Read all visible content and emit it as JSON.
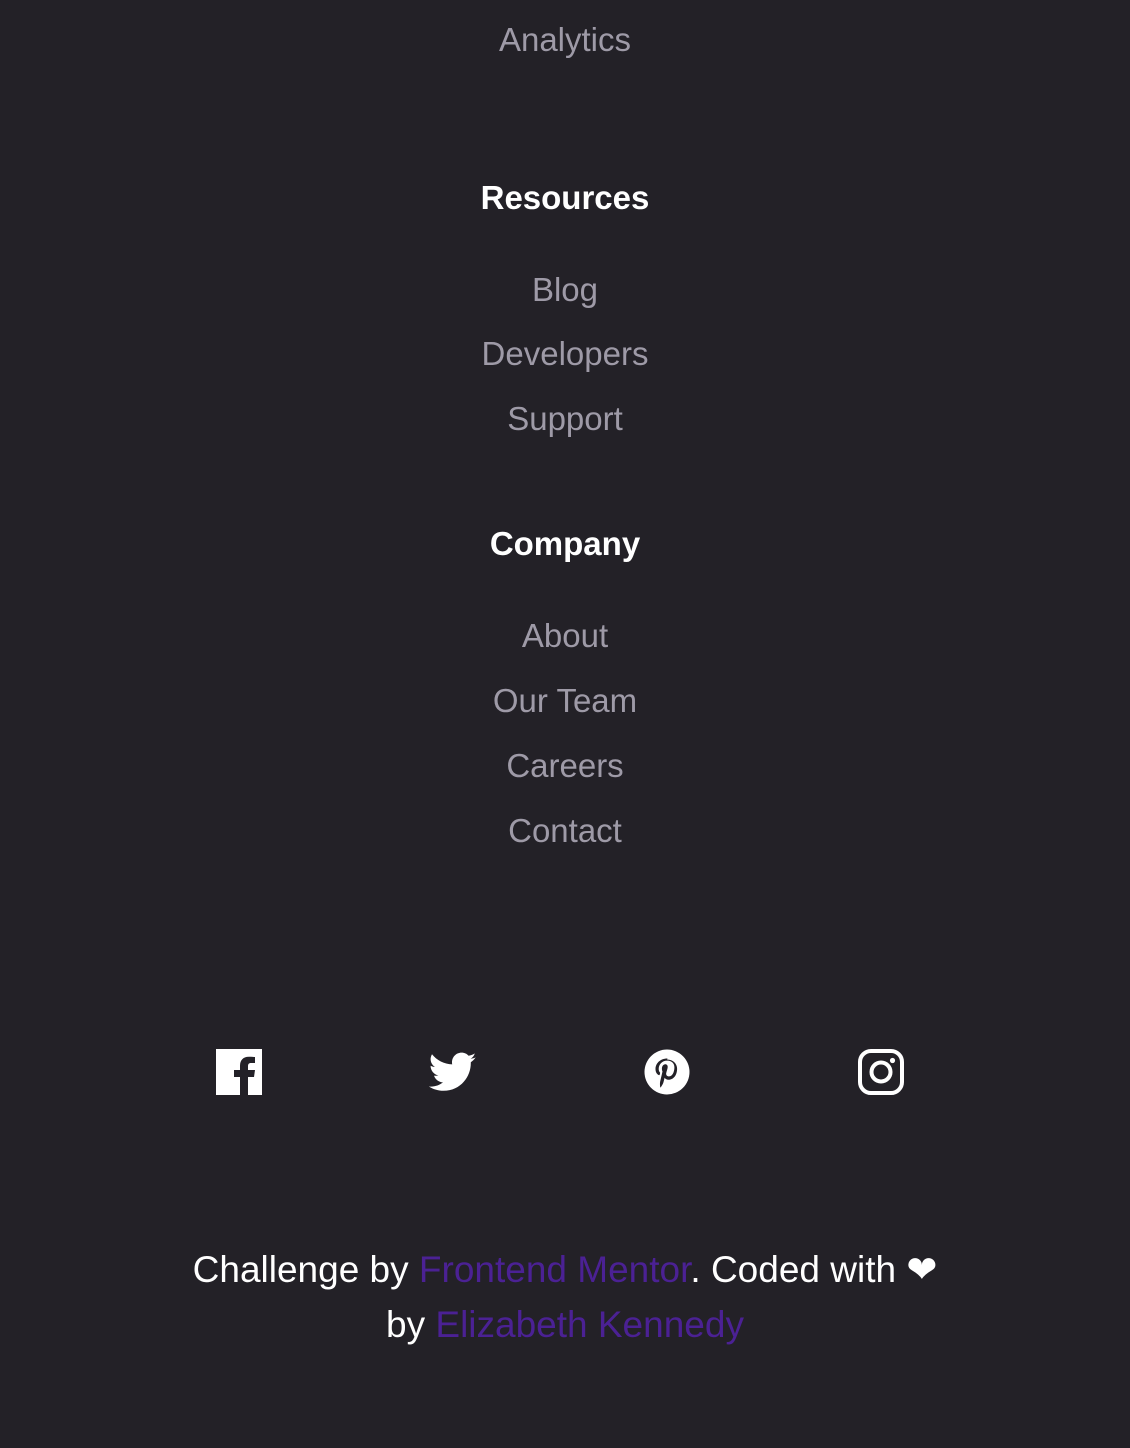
{
  "features": {
    "items": [
      {
        "label": "Analytics"
      }
    ]
  },
  "resources": {
    "title": "Resources",
    "items": [
      {
        "label": "Blog"
      },
      {
        "label": "Developers"
      },
      {
        "label": "Support"
      }
    ]
  },
  "company": {
    "title": "Company",
    "items": [
      {
        "label": "About"
      },
      {
        "label": "Our Team"
      },
      {
        "label": "Careers"
      },
      {
        "label": "Contact"
      }
    ]
  },
  "social": {
    "icons": [
      "facebook-icon",
      "twitter-icon",
      "pinterest-icon",
      "instagram-icon"
    ]
  },
  "attribution": {
    "prefix": "Challenge by ",
    "fm_link": "Frontend Mentor",
    "middle": ". Coded with ❤",
    "by": " by ",
    "author_link": "Elizabeth Kennedy"
  },
  "colors": {
    "background": "#232127",
    "link_text": "#9e9aa7",
    "heading_text": "#ffffff",
    "accent": "#4b2194"
  }
}
